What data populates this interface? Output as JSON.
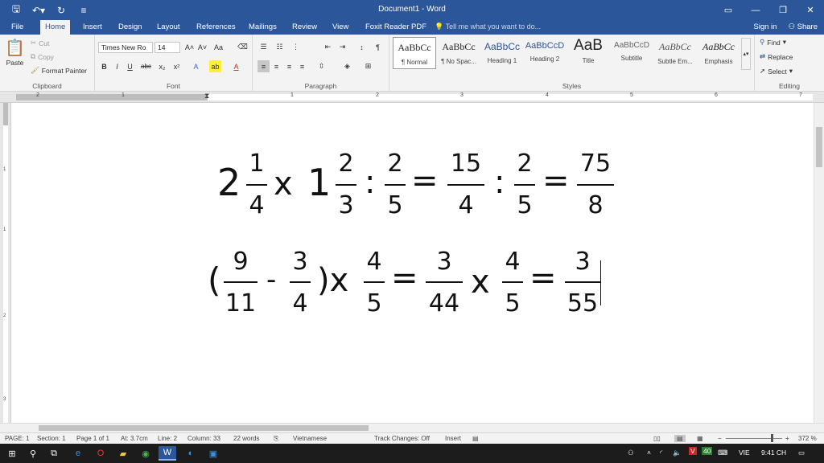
{
  "titlebar": {
    "title": "Document1 - Word",
    "qat": {
      "save": "🖫",
      "undo": "↶▾",
      "redo": "↻",
      "customize": "≡"
    },
    "controls": {
      "ribbon_display": "▭",
      "minimize": "—",
      "restore": "❐",
      "close": "✕"
    }
  },
  "tabs": {
    "items": [
      "File",
      "Home",
      "Insert",
      "Design",
      "Layout",
      "References",
      "Mailings",
      "Review",
      "View",
      "Foxit Reader PDF"
    ],
    "tell_me": "Tell me what you want to do...",
    "sign_in": "Sign in",
    "share": "Share"
  },
  "ribbon": {
    "clipboard": {
      "paste": "Paste",
      "cut": "Cut",
      "copy": "Copy",
      "format_painter": "Format Painter",
      "label": "Clipboard"
    },
    "font": {
      "font_name": "Times New Ro",
      "font_size": "14",
      "bold": "B",
      "italic": "I",
      "underline": "U",
      "strike": "abc",
      "subscript": "x₂",
      "superscript": "x²",
      "grow": "A˄",
      "shrink": "A˅",
      "case": "Aa",
      "label": "Font"
    },
    "paragraph": {
      "label": "Paragraph"
    },
    "styles": {
      "items": [
        {
          "preview": "AaBbCc",
          "name": "¶ Normal"
        },
        {
          "preview": "AaBbCc",
          "name": "¶ No Spac..."
        },
        {
          "preview": "AaBbCc",
          "name": "Heading 1"
        },
        {
          "preview": "AaBbCcD",
          "name": "Heading 2"
        },
        {
          "preview": "AaB",
          "name": "Title"
        },
        {
          "preview": "AaBbCcD",
          "name": "Subtitle"
        },
        {
          "preview": "AaBbCc",
          "name": "Subtle Em..."
        },
        {
          "preview": "AaBbCc",
          "name": "Emphasis"
        }
      ],
      "label": "Styles"
    },
    "editing": {
      "find": "Find",
      "replace": "Replace",
      "select": "Select",
      "label": "Editing"
    }
  },
  "ruler": {
    "numbers": [
      "2",
      "1",
      "1",
      "1",
      "2",
      "3",
      "4",
      "5",
      "6",
      "7"
    ]
  },
  "vruler": {
    "numbers": [
      "1",
      "1",
      "2",
      "3"
    ]
  },
  "document": {
    "line1": {
      "whole1": "2",
      "n1": "1",
      "d1": "4",
      "op1": "x",
      "whole2": "1",
      "n2": "2",
      "d2": "3",
      "op2": ":",
      "n3": "2",
      "d3": "5",
      "eq1": "=",
      "n4": "15",
      "d4": "4",
      "op3": ":",
      "n5": "2",
      "d5": "5",
      "eq2": "=",
      "n6": "75",
      "d6": "8"
    },
    "line2": {
      "lparen": "(",
      "n1": "9",
      "d1": "11",
      "op1": "-",
      "n2": "3",
      "d2": "4",
      "rparen": ")x",
      "n3": "4",
      "d3": "5",
      "eq1": "=",
      "n4": "3",
      "d4": "44",
      "op2": "x",
      "n5": "4",
      "d5": "5",
      "eq2": "=",
      "n6": "3",
      "d6": "55"
    }
  },
  "statusbar": {
    "page": "PAGE: 1",
    "section": "Section: 1",
    "page_of": "Page 1 of 1",
    "at": "At: 3.7cm",
    "line": "Line: 2",
    "column": "Column: 33",
    "words": "22 words",
    "language": "Vietnamese",
    "track": "Track Changes: Off",
    "mode": "Insert",
    "zoom": "372 %"
  },
  "taskbar": {
    "lang": "VIE",
    "time": "9:41 CH",
    "badge": "40"
  },
  "colors": {
    "word_blue": "#2b579a",
    "taskbar": "#1c1c1c"
  }
}
